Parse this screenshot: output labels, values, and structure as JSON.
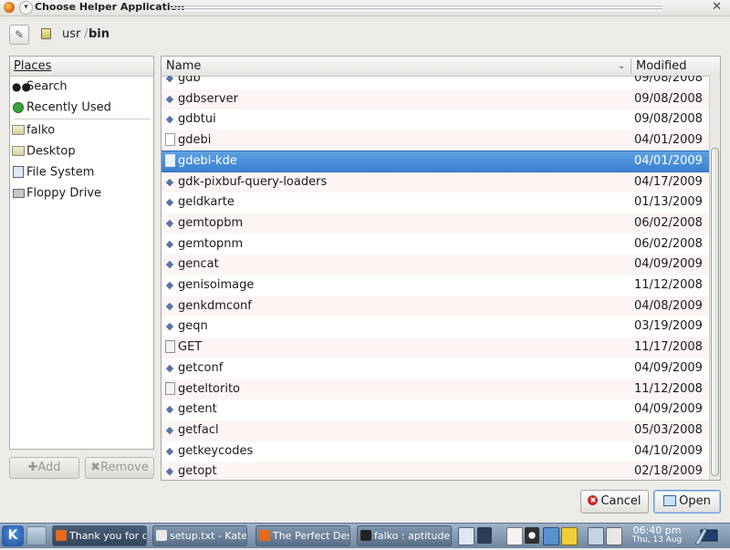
{
  "window": {
    "title": "Choose Helper Application",
    "close_glyph": "✕",
    "menu_glyph": "▾"
  },
  "pathbar": {
    "edit_icon": "pencil-icon",
    "crumbs": [
      "usr",
      "bin"
    ],
    "separator": "/"
  },
  "places": {
    "header": "Places",
    "items": [
      {
        "label": "Search",
        "icon": "binoculars-icon"
      },
      {
        "label": "Recently Used",
        "icon": "clock-icon"
      },
      {
        "label": "falko",
        "icon": "folder-icon"
      },
      {
        "label": "Desktop",
        "icon": "folder-icon"
      },
      {
        "label": "File System",
        "icon": "filesystem-icon"
      },
      {
        "label": "Floppy Drive",
        "icon": "floppy-icon"
      }
    ],
    "add_label": "Add",
    "remove_label": "Remove"
  },
  "filelist": {
    "col_name": "Name",
    "col_modified": "Modified",
    "selected_index": 4,
    "rows": [
      {
        "name": "gdb",
        "date": "09/08/2008",
        "icon": "exec"
      },
      {
        "name": "gdbserver",
        "date": "09/08/2008",
        "icon": "exec"
      },
      {
        "name": "gdbtui",
        "date": "09/08/2008",
        "icon": "exec"
      },
      {
        "name": "gdebi",
        "date": "04/01/2009",
        "icon": "doc"
      },
      {
        "name": "gdebi-kde",
        "date": "04/01/2009",
        "icon": "doc"
      },
      {
        "name": "gdk-pixbuf-query-loaders",
        "date": "04/17/2009",
        "icon": "exec"
      },
      {
        "name": "geldkarte",
        "date": "01/13/2009",
        "icon": "exec"
      },
      {
        "name": "gemtopbm",
        "date": "06/02/2008",
        "icon": "exec"
      },
      {
        "name": "gemtopnm",
        "date": "06/02/2008",
        "icon": "exec"
      },
      {
        "name": "gencat",
        "date": "04/09/2009",
        "icon": "exec"
      },
      {
        "name": "genisoimage",
        "date": "11/12/2008",
        "icon": "exec"
      },
      {
        "name": "genkdmconf",
        "date": "04/08/2009",
        "icon": "exec"
      },
      {
        "name": "geqn",
        "date": "03/19/2009",
        "icon": "exec"
      },
      {
        "name": "GET",
        "date": "11/17/2008",
        "icon": "script"
      },
      {
        "name": "getconf",
        "date": "04/09/2009",
        "icon": "exec"
      },
      {
        "name": "geteltorito",
        "date": "11/12/2008",
        "icon": "script"
      },
      {
        "name": "getent",
        "date": "04/09/2009",
        "icon": "exec"
      },
      {
        "name": "getfacl",
        "date": "05/03/2008",
        "icon": "exec"
      },
      {
        "name": "getkeycodes",
        "date": "04/10/2009",
        "icon": "exec"
      },
      {
        "name": "getopt",
        "date": "02/18/2009",
        "icon": "exec"
      }
    ]
  },
  "buttons": {
    "cancel": "Cancel",
    "open": "Open"
  },
  "taskbar": {
    "tasks": [
      {
        "label": "Thank you for do",
        "active": true,
        "color": "#e86a1a"
      },
      {
        "label": "setup.txt - Kate",
        "active": false,
        "color": "#e8e8e8"
      },
      {
        "label": "The Perfect Desk",
        "active": false,
        "color": "#e86a1a"
      },
      {
        "label": "falko : aptitude",
        "active": false,
        "color": "#222222"
      }
    ],
    "clock_time": "06:40 pm",
    "clock_date": "Thu, 13 Aug"
  }
}
